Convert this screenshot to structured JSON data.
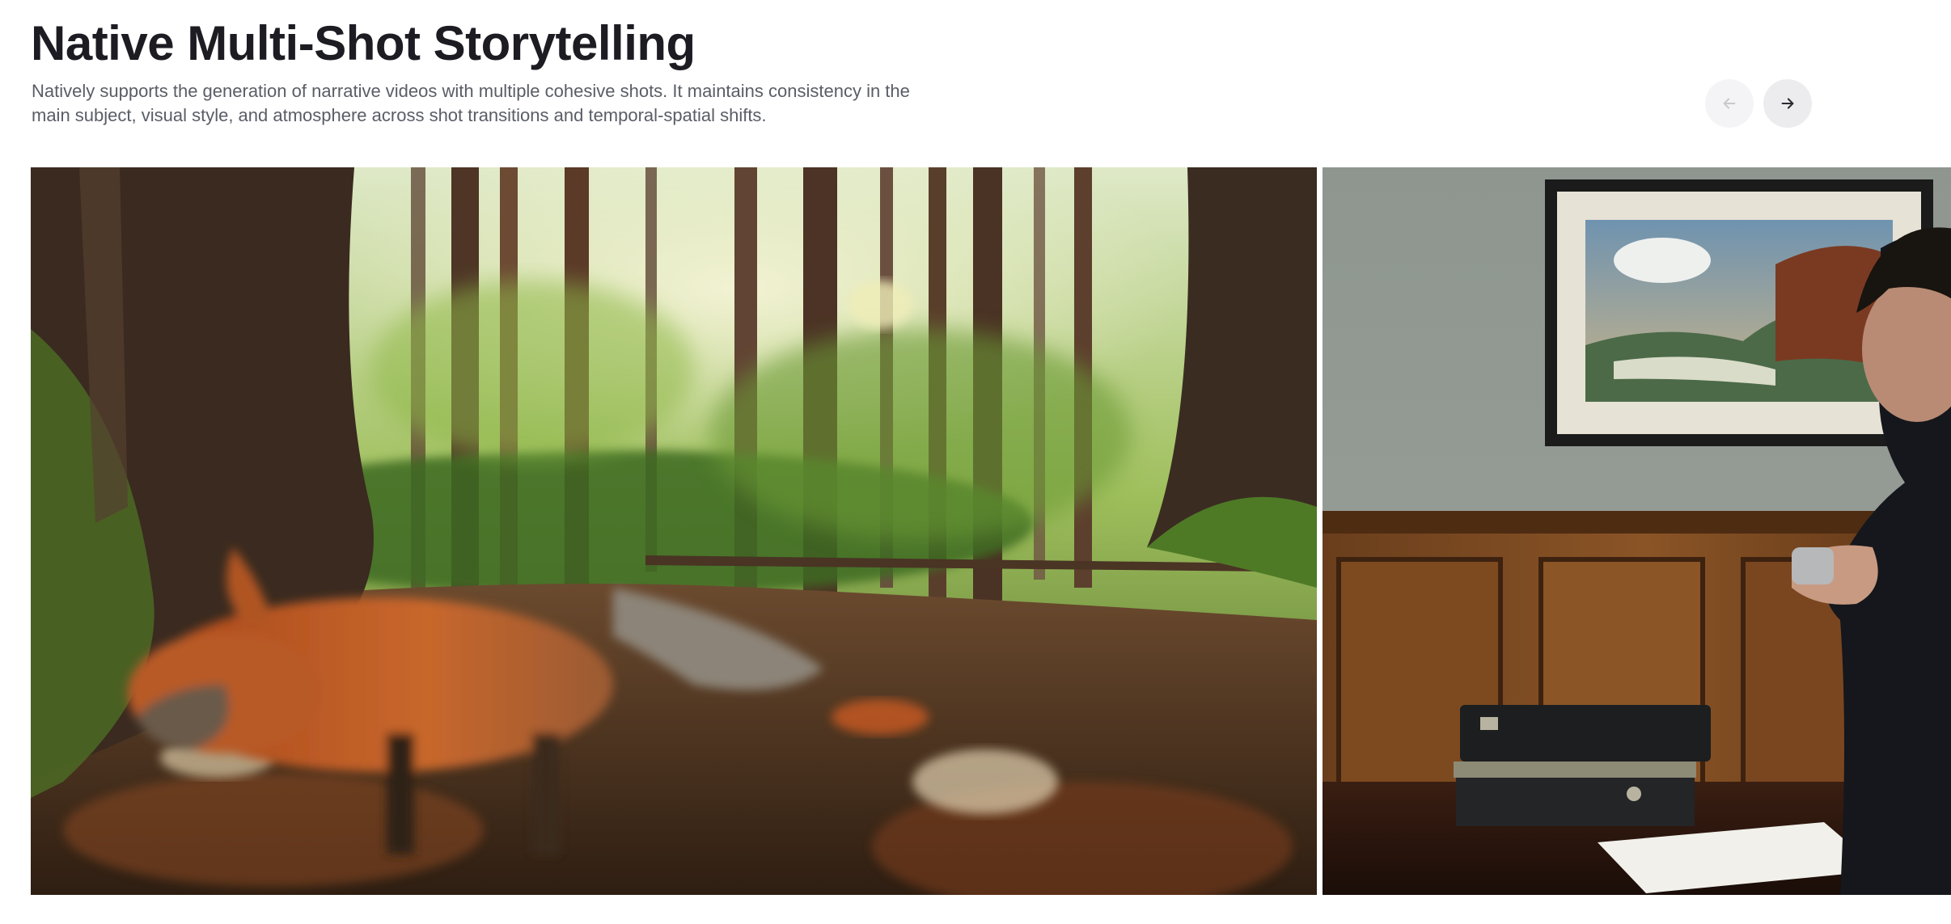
{
  "section": {
    "title": "Native Multi-Shot Storytelling",
    "description": "Natively supports the generation of narrative videos with multiple cohesive shots. It maintains consistency in the main subject, visual style, and atmosphere across shot transitions and temporal-spatial shifts."
  },
  "carousel": {
    "prev_icon": "arrow-left-icon",
    "next_icon": "arrow-right-icon",
    "prev_disabled": true,
    "slides": [
      {
        "image": "fox-running-in-forest",
        "accent": "#c25a22"
      },
      {
        "image": "man-in-suit-at-desk-with-box",
        "accent": "#7a4a22"
      }
    ]
  },
  "colors": {
    "title": "#1c1c22",
    "description": "#5a5d66",
    "nav_bg_disabled": "#f4f4f6",
    "nav_bg": "#ececef",
    "icon_disabled": "#c8c9ce",
    "icon": "#2a2b30"
  }
}
